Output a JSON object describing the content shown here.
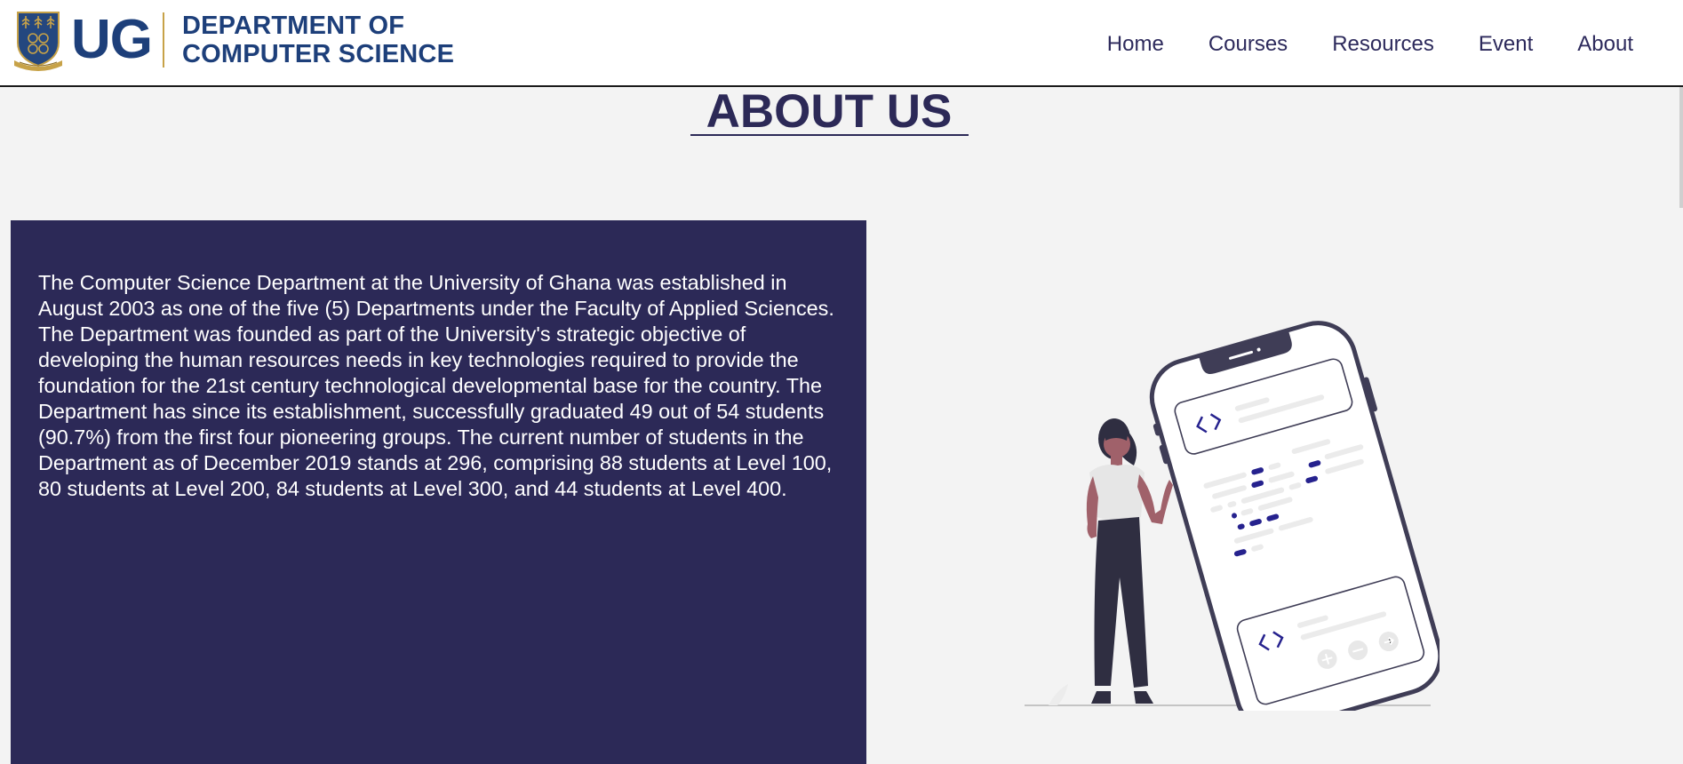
{
  "header": {
    "logo_text": "UG",
    "department_line1": "DEPARTMENT OF",
    "department_line2": "COMPUTER SCIENCE"
  },
  "nav": {
    "items": [
      "Home",
      "Courses",
      "Resources",
      "Event",
      "About"
    ]
  },
  "main": {
    "title": "ABOUT US",
    "about_text": "The Computer Science Department at the University of Ghana was established in August 2003 as one of the five (5) Departments under the Faculty of Applied Sciences. The Department was founded as part of the University's strategic objective of developing the human resources needs in key technologies required to provide the foundation for the 21st century technological developmental base for the country. The Department has since its establishment, successfully graduated 49 out of 54 students (90.7%) from the first four pioneering groups. The current number of students in the Department as of December 2019 stands at 296, comprising 88 students at Level 100, 80 students at Level 200, 84 students at Level 300, and 44 students at Level 400."
  },
  "colors": {
    "brand_navy": "#2c2957",
    "logo_blue": "#1d3f7a",
    "logo_gold": "#c7a248",
    "page_background": "#f3f3f3"
  },
  "icons": {
    "crest": "university-crest-icon",
    "illustration": "woman-with-phone-illustration"
  }
}
